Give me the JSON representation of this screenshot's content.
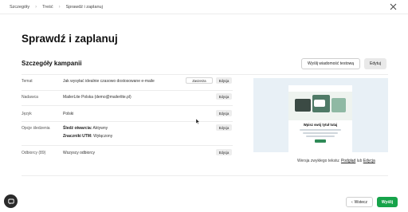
{
  "breadcrumb": {
    "items": [
      "Szczegóły",
      "Treść",
      "Sprawdź i zaplanuj"
    ]
  },
  "page": {
    "title": "Sprawdź i zaplanuj"
  },
  "campaign": {
    "section_title": "Szczegóły kampanii",
    "send_test_label": "Wyślij wiadomość testową",
    "edit_label": "Edytuj",
    "rows": {
      "subject": {
        "label": "Temat",
        "value": "Jak wysyłać idealnie czasowo dostosowane e-maile",
        "badge": "Zaszerza",
        "edit": "Edycja"
      },
      "sender": {
        "label": "Nadawca",
        "value": "MailerLite Polska (demo@mailerlite.pl)",
        "edit": "Edycja"
      },
      "language": {
        "label": "Język",
        "value": "Polski",
        "edit": "Edycja"
      },
      "tracking": {
        "label": "Opcje śledzenia",
        "open_tracking_label": "Śledź otwarcia:",
        "open_tracking_value": "Aktywny",
        "utm_label": "Znaczniki UTM:",
        "utm_value": "Wyłączony",
        "edit": "Edycja"
      },
      "recipients": {
        "label": "Odbiorcy (89)",
        "value": "Wszyscy odbiorcy",
        "edit": "Edycja"
      }
    }
  },
  "preview": {
    "headline": "Wpisz swój tytuł tutaj",
    "plain_text_prefix": "Wersja zwykłego tekstu:",
    "preview_link": "Podgląd",
    "or_text": "lub",
    "edit_link": "Edycja"
  },
  "footer": {
    "back_label": "Wstecz",
    "send_label": "Wyślij"
  },
  "colors": {
    "accent": "#16a34a",
    "preview_bg": "#e8f0f6"
  },
  "icons": [
    "chevron-right-icon",
    "close-icon",
    "chat-icon",
    "chevron-left-icon",
    "mouse-cursor-icon"
  ]
}
